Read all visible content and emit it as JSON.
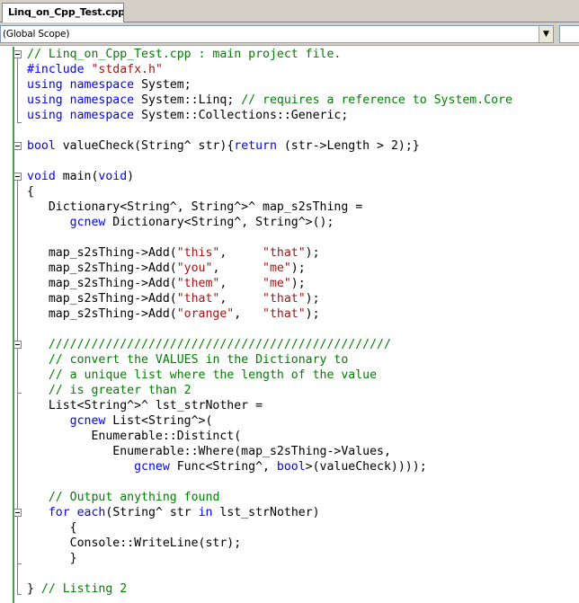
{
  "tab": {
    "label": "Linq_on_Cpp_Test.cpp"
  },
  "scope": {
    "value": "(Global Scope)"
  },
  "editor": {
    "lines": [
      [
        [
          "cmt",
          "// Linq_on_Cpp_Test.cpp : main project file."
        ]
      ],
      [
        [
          "pp",
          "#include"
        ],
        [
          "plain",
          " "
        ],
        [
          "str",
          "\"stdafx.h\""
        ]
      ],
      [
        [
          "kw",
          "using"
        ],
        [
          "plain",
          " "
        ],
        [
          "kw",
          "namespace"
        ],
        [
          "plain",
          " System;"
        ]
      ],
      [
        [
          "kw",
          "using"
        ],
        [
          "plain",
          " "
        ],
        [
          "kw",
          "namespace"
        ],
        [
          "plain",
          " System::Linq; "
        ],
        [
          "cmt",
          "// requires a reference to System.Core"
        ]
      ],
      [
        [
          "kw",
          "using"
        ],
        [
          "plain",
          " "
        ],
        [
          "kw",
          "namespace"
        ],
        [
          "plain",
          " System::Collections::Generic;"
        ]
      ],
      [
        [
          "plain",
          ""
        ]
      ],
      [
        [
          "kw",
          "bool"
        ],
        [
          "plain",
          " valueCheck(String^ str){"
        ],
        [
          "kw",
          "return"
        ],
        [
          "plain",
          " (str->Length > 2);}"
        ]
      ],
      [
        [
          "plain",
          ""
        ]
      ],
      [
        [
          "kw",
          "void"
        ],
        [
          "plain",
          " main("
        ],
        [
          "kw",
          "void"
        ],
        [
          "plain",
          ")"
        ]
      ],
      [
        [
          "plain",
          "{"
        ]
      ],
      [
        [
          "plain",
          "   Dictionary<String^, String^>^ map_s2sThing ="
        ]
      ],
      [
        [
          "plain",
          "      "
        ],
        [
          "kw",
          "gcnew"
        ],
        [
          "plain",
          " Dictionary<String^, String^>();"
        ]
      ],
      [
        [
          "plain",
          ""
        ]
      ],
      [
        [
          "plain",
          "   map_s2sThing->Add("
        ],
        [
          "str",
          "\"this\""
        ],
        [
          "plain",
          ",     "
        ],
        [
          "str",
          "\"that\""
        ],
        [
          "plain",
          ");"
        ]
      ],
      [
        [
          "plain",
          "   map_s2sThing->Add("
        ],
        [
          "str",
          "\"you\""
        ],
        [
          "plain",
          ",      "
        ],
        [
          "str",
          "\"me\""
        ],
        [
          "plain",
          ");"
        ]
      ],
      [
        [
          "plain",
          "   map_s2sThing->Add("
        ],
        [
          "str",
          "\"them\""
        ],
        [
          "plain",
          ",     "
        ],
        [
          "str",
          "\"me\""
        ],
        [
          "plain",
          ");"
        ]
      ],
      [
        [
          "plain",
          "   map_s2sThing->Add("
        ],
        [
          "str",
          "\"that\""
        ],
        [
          "plain",
          ",     "
        ],
        [
          "str",
          "\"that\""
        ],
        [
          "plain",
          ");"
        ]
      ],
      [
        [
          "plain",
          "   map_s2sThing->Add("
        ],
        [
          "str",
          "\"orange\""
        ],
        [
          "plain",
          ",   "
        ],
        [
          "str",
          "\"that\""
        ],
        [
          "plain",
          ");"
        ]
      ],
      [
        [
          "plain",
          ""
        ]
      ],
      [
        [
          "plain",
          "   "
        ],
        [
          "cmt",
          "////////////////////////////////////////////////"
        ]
      ],
      [
        [
          "plain",
          "   "
        ],
        [
          "cmt",
          "// convert the VALUES in the Dictionary to"
        ]
      ],
      [
        [
          "plain",
          "   "
        ],
        [
          "cmt",
          "// a unique list where the length of the value"
        ]
      ],
      [
        [
          "plain",
          "   "
        ],
        [
          "cmt",
          "// is greater than 2"
        ]
      ],
      [
        [
          "plain",
          "   List<String^>^ lst_strNother ="
        ]
      ],
      [
        [
          "plain",
          "      "
        ],
        [
          "kw",
          "gcnew"
        ],
        [
          "plain",
          " List<String^>("
        ]
      ],
      [
        [
          "plain",
          "         Enumerable::Distinct("
        ]
      ],
      [
        [
          "plain",
          "            Enumerable::Where(map_s2sThing->Values,"
        ]
      ],
      [
        [
          "plain",
          "               "
        ],
        [
          "kw",
          "gcnew"
        ],
        [
          "plain",
          " Func<String^, "
        ],
        [
          "kw",
          "bool"
        ],
        [
          "plain",
          ">(valueCheck))));"
        ]
      ],
      [
        [
          "plain",
          ""
        ]
      ],
      [
        [
          "plain",
          "   "
        ],
        [
          "cmt",
          "// Output anything found"
        ]
      ],
      [
        [
          "plain",
          "   "
        ],
        [
          "kw",
          "for"
        ],
        [
          "plain",
          " "
        ],
        [
          "kw",
          "each"
        ],
        [
          "plain",
          "(String^ str "
        ],
        [
          "kw",
          "in"
        ],
        [
          "plain",
          " lst_strNother)"
        ]
      ],
      [
        [
          "plain",
          "      {"
        ]
      ],
      [
        [
          "plain",
          "      Console::WriteLine(str);"
        ]
      ],
      [
        [
          "plain",
          "      }"
        ]
      ],
      [
        [
          "plain",
          ""
        ]
      ],
      [
        [
          "plain",
          "} "
        ],
        [
          "cmt",
          "// Listing 2"
        ]
      ]
    ]
  }
}
